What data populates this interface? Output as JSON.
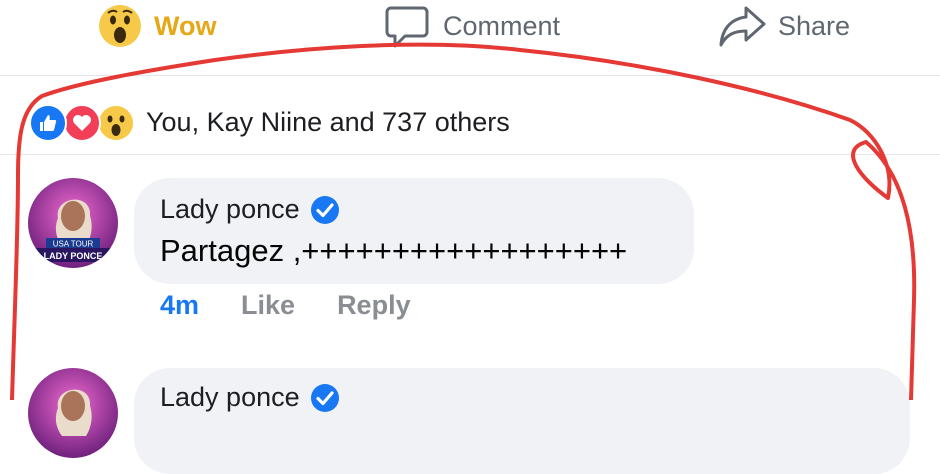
{
  "actions": {
    "wow_label": "Wow",
    "comment_label": "Comment",
    "share_label": "Share"
  },
  "reactions": {
    "summary": "You, Kay Niine and 737 others"
  },
  "comments": [
    {
      "author": "Lady ponce",
      "verified": true,
      "text": "Partagez ,++++++++++++++++++",
      "time": "4m",
      "like_label": "Like",
      "reply_label": "Reply",
      "avatar_caption": "USA TOUR",
      "avatar_name": "LADY PONCE"
    },
    {
      "author": "Lady ponce",
      "verified": true
    }
  ],
  "colors": {
    "wow_accent": "#e6a817",
    "link_blue": "#1877f2",
    "annotation_red": "#e53935"
  }
}
